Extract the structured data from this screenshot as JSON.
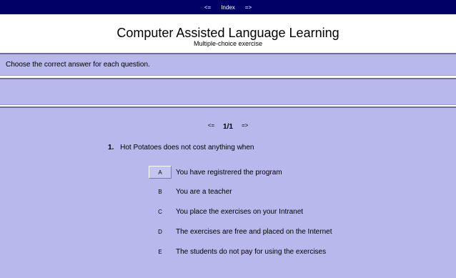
{
  "topbar": {
    "prev": "<=",
    "index": "Index",
    "next": "=>"
  },
  "header": {
    "title": "Computer Assisted Language Learning",
    "subtitle": "Multiple-choice exercise"
  },
  "instructions": "Choose the correct answer for each question.",
  "nav": {
    "prev": "<=",
    "counter": "1/1",
    "next": "=>"
  },
  "question": {
    "number": "1.",
    "text": "Hot Potatoes does not cost anything when"
  },
  "answers": [
    {
      "letter": "A",
      "text": "You have registrered the program",
      "selected": true
    },
    {
      "letter": "B",
      "text": "You are a teacher"
    },
    {
      "letter": "C",
      "text": "You place the exercises on your Intranet"
    },
    {
      "letter": "D",
      "text": "The exercises are free and placed on the Internet"
    },
    {
      "letter": "E",
      "text": "The students do not pay for using the exercises"
    }
  ]
}
